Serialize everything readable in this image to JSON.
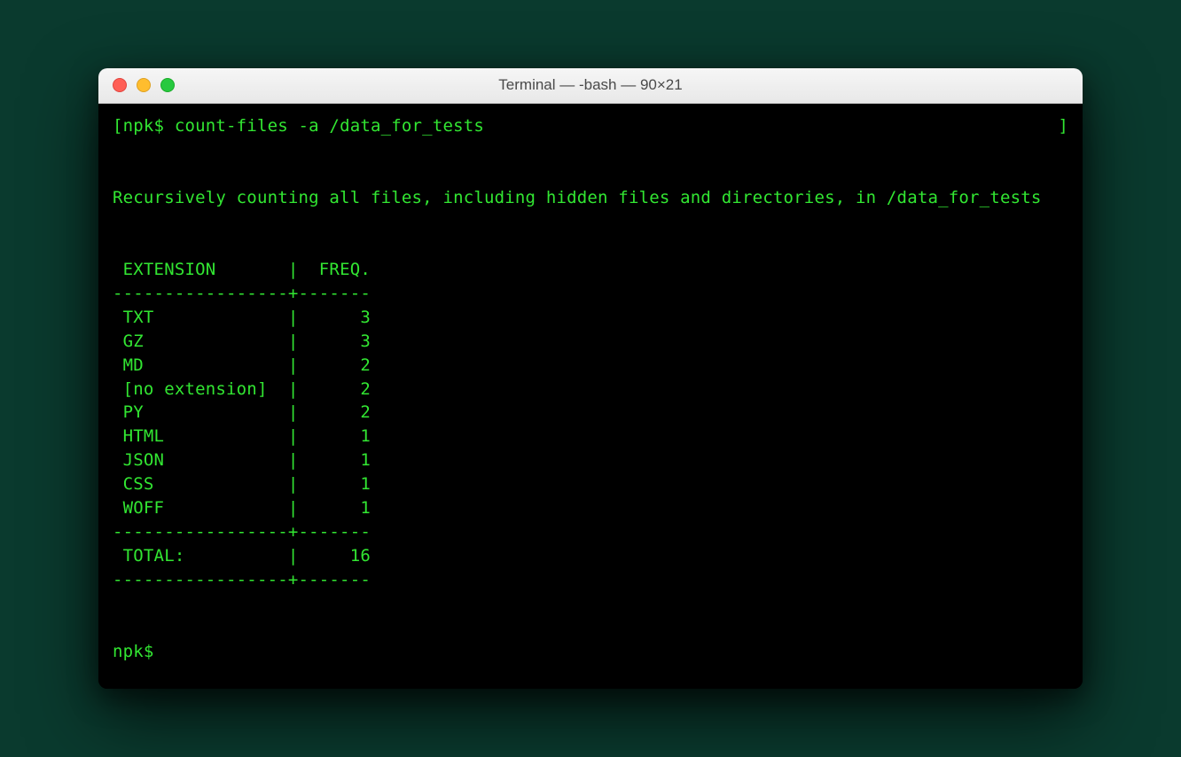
{
  "window": {
    "title": "Terminal — -bash — 90×21"
  },
  "terminal": {
    "prompt_open": "[",
    "prompt_close": "]",
    "prompt": "npk$",
    "command": "count-files -a /data_for_tests",
    "message": "Recursively counting all files, including hidden files and directories, in /data_for_tests",
    "header_ext": "EXTENSION",
    "header_freq": "FREQ.",
    "rows": [
      {
        "ext": "TXT",
        "freq": "3"
      },
      {
        "ext": "GZ",
        "freq": "3"
      },
      {
        "ext": "MD",
        "freq": "2"
      },
      {
        "ext": "[no extension]",
        "freq": "2"
      },
      {
        "ext": "PY",
        "freq": "2"
      },
      {
        "ext": "HTML",
        "freq": "1"
      },
      {
        "ext": "JSON",
        "freq": "1"
      },
      {
        "ext": "CSS",
        "freq": "1"
      },
      {
        "ext": "WOFF",
        "freq": "1"
      }
    ],
    "divider": "-----------------+-------",
    "total_label": "TOTAL:",
    "total_value": "16",
    "next_prompt": "npk$ "
  }
}
